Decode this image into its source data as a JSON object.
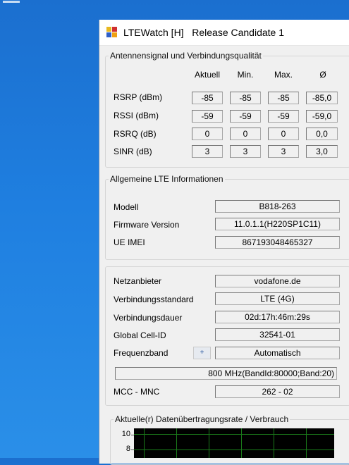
{
  "window": {
    "title": "LTEWatch [H]   Release Candidate 1"
  },
  "signal": {
    "legend": "Antennensignal und Verbindungsqualität",
    "headers": [
      "Aktuell",
      "Min.",
      "Max.",
      "Ø"
    ],
    "rows": [
      {
        "label": "RSRP (dBm)",
        "values": [
          "-85",
          "-85",
          "-85",
          "-85,0"
        ]
      },
      {
        "label": "RSSI (dBm)",
        "values": [
          "-59",
          "-59",
          "-59",
          "-59,0"
        ]
      },
      {
        "label": "RSRQ (dB)",
        "values": [
          "0",
          "0",
          "0",
          "0,0"
        ]
      },
      {
        "label": "SINR (dB)",
        "values": [
          "3",
          "3",
          "3",
          "3,0"
        ]
      }
    ]
  },
  "lte": {
    "legend": "Allgemeine LTE Informationen",
    "modell_label": "Modell",
    "modell": "B818-263",
    "firmware_label": "Firmware Version",
    "firmware": "11.0.1.1(H220SP1C11)",
    "imei_label": "UE IMEI",
    "imei": "867193048465327"
  },
  "network": {
    "provider_label": "Netzanbieter",
    "provider": "vodafone.de",
    "standard_label": "Verbindungsstandard",
    "standard": "LTE (4G)",
    "duration_label": "Verbindungsdauer",
    "duration": "02d:17h:46m:29s",
    "cellid_label": "Global Cell-ID",
    "cellid": "32541-01",
    "band_label": "Frequenzband",
    "band_button": "+",
    "band_mode": "Automatisch",
    "band_detail": "800 MHz(BandId:80000;Band:20)",
    "mcc_label": "MCC - MNC",
    "mcc": "262 - 02"
  },
  "rate": {
    "legend": "Aktuelle(r) Datenübertragungsrate / Verbrauch",
    "y_labels": [
      "10",
      "8"
    ]
  }
}
